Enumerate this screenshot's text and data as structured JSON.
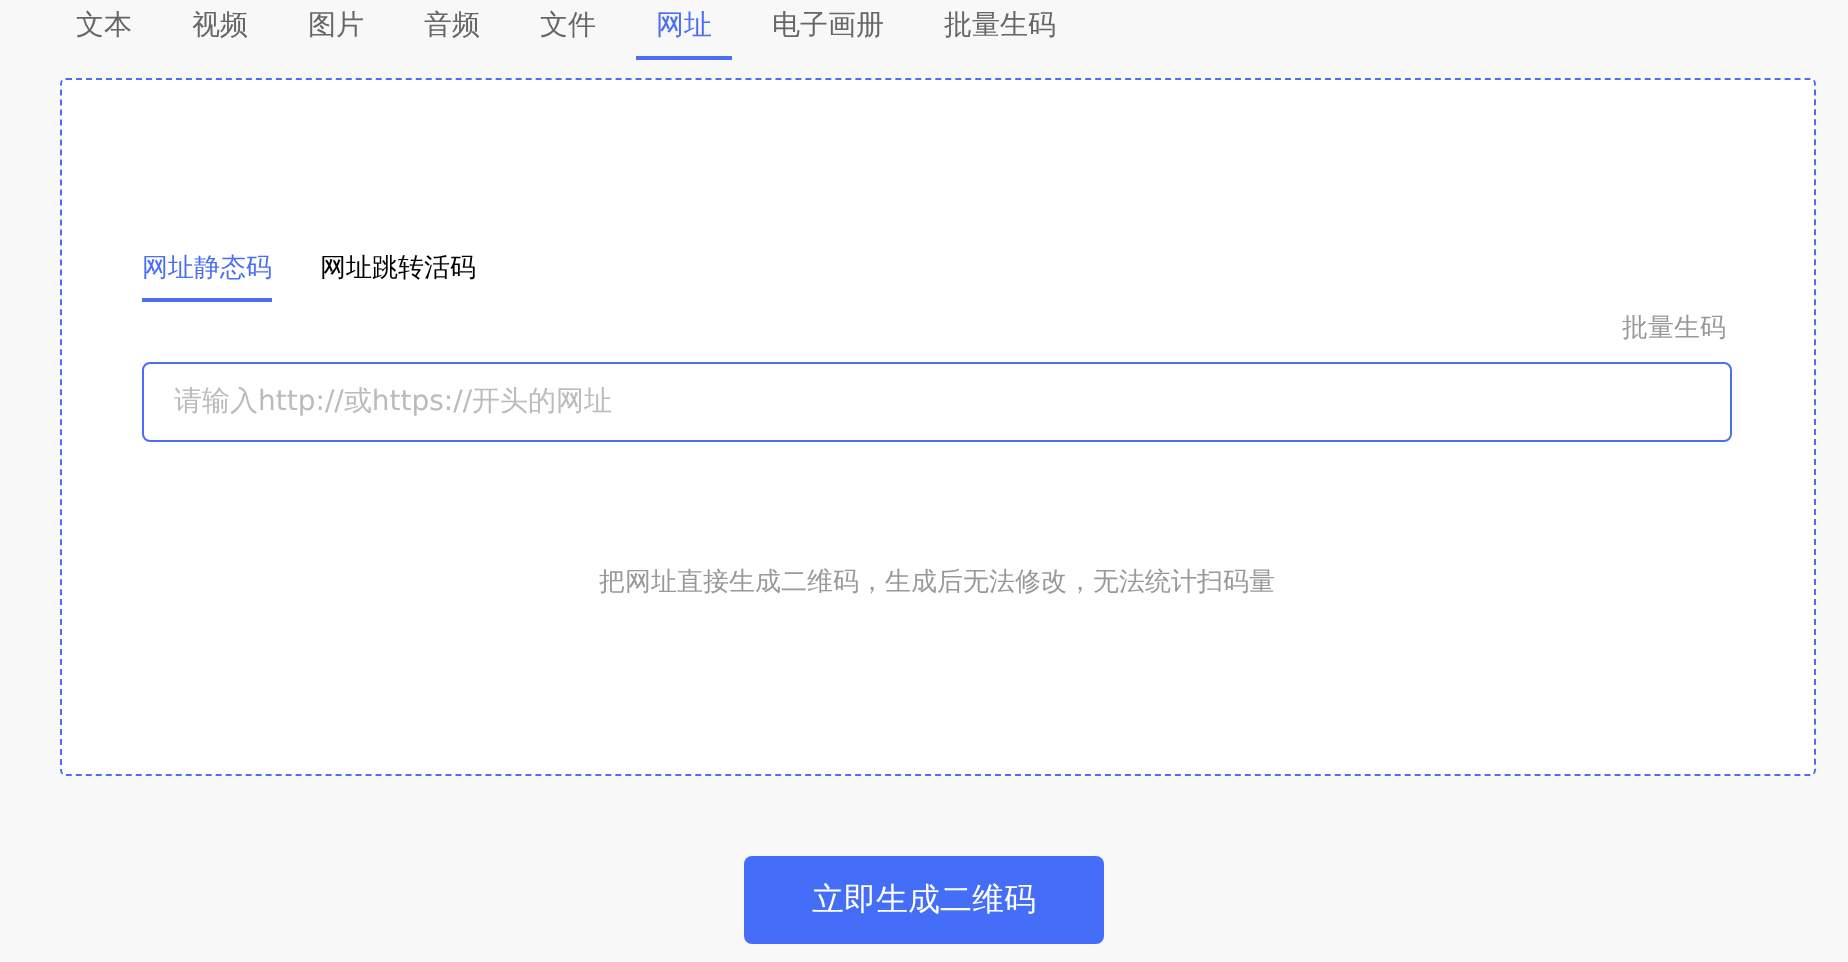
{
  "tabs": [
    {
      "label": "文本",
      "selected": false
    },
    {
      "label": "视频",
      "selected": false
    },
    {
      "label": "图片",
      "selected": false
    },
    {
      "label": "音频",
      "selected": false
    },
    {
      "label": "文件",
      "selected": false
    },
    {
      "label": "网址",
      "selected": true
    },
    {
      "label": "电子画册",
      "selected": false
    },
    {
      "label": "批量生码",
      "selected": false
    }
  ],
  "sub_tabs": [
    {
      "label": "网址静态码",
      "selected": true
    },
    {
      "label": "网址跳转活码",
      "selected": false
    }
  ],
  "batch_link": "批量生码",
  "url_field": {
    "placeholder": "请输入http://或https://开头的网址"
  },
  "note": "把网址直接生成二维码，生成后无法修改，无法统计扫码量",
  "submit_button": "立即生成二维码"
}
